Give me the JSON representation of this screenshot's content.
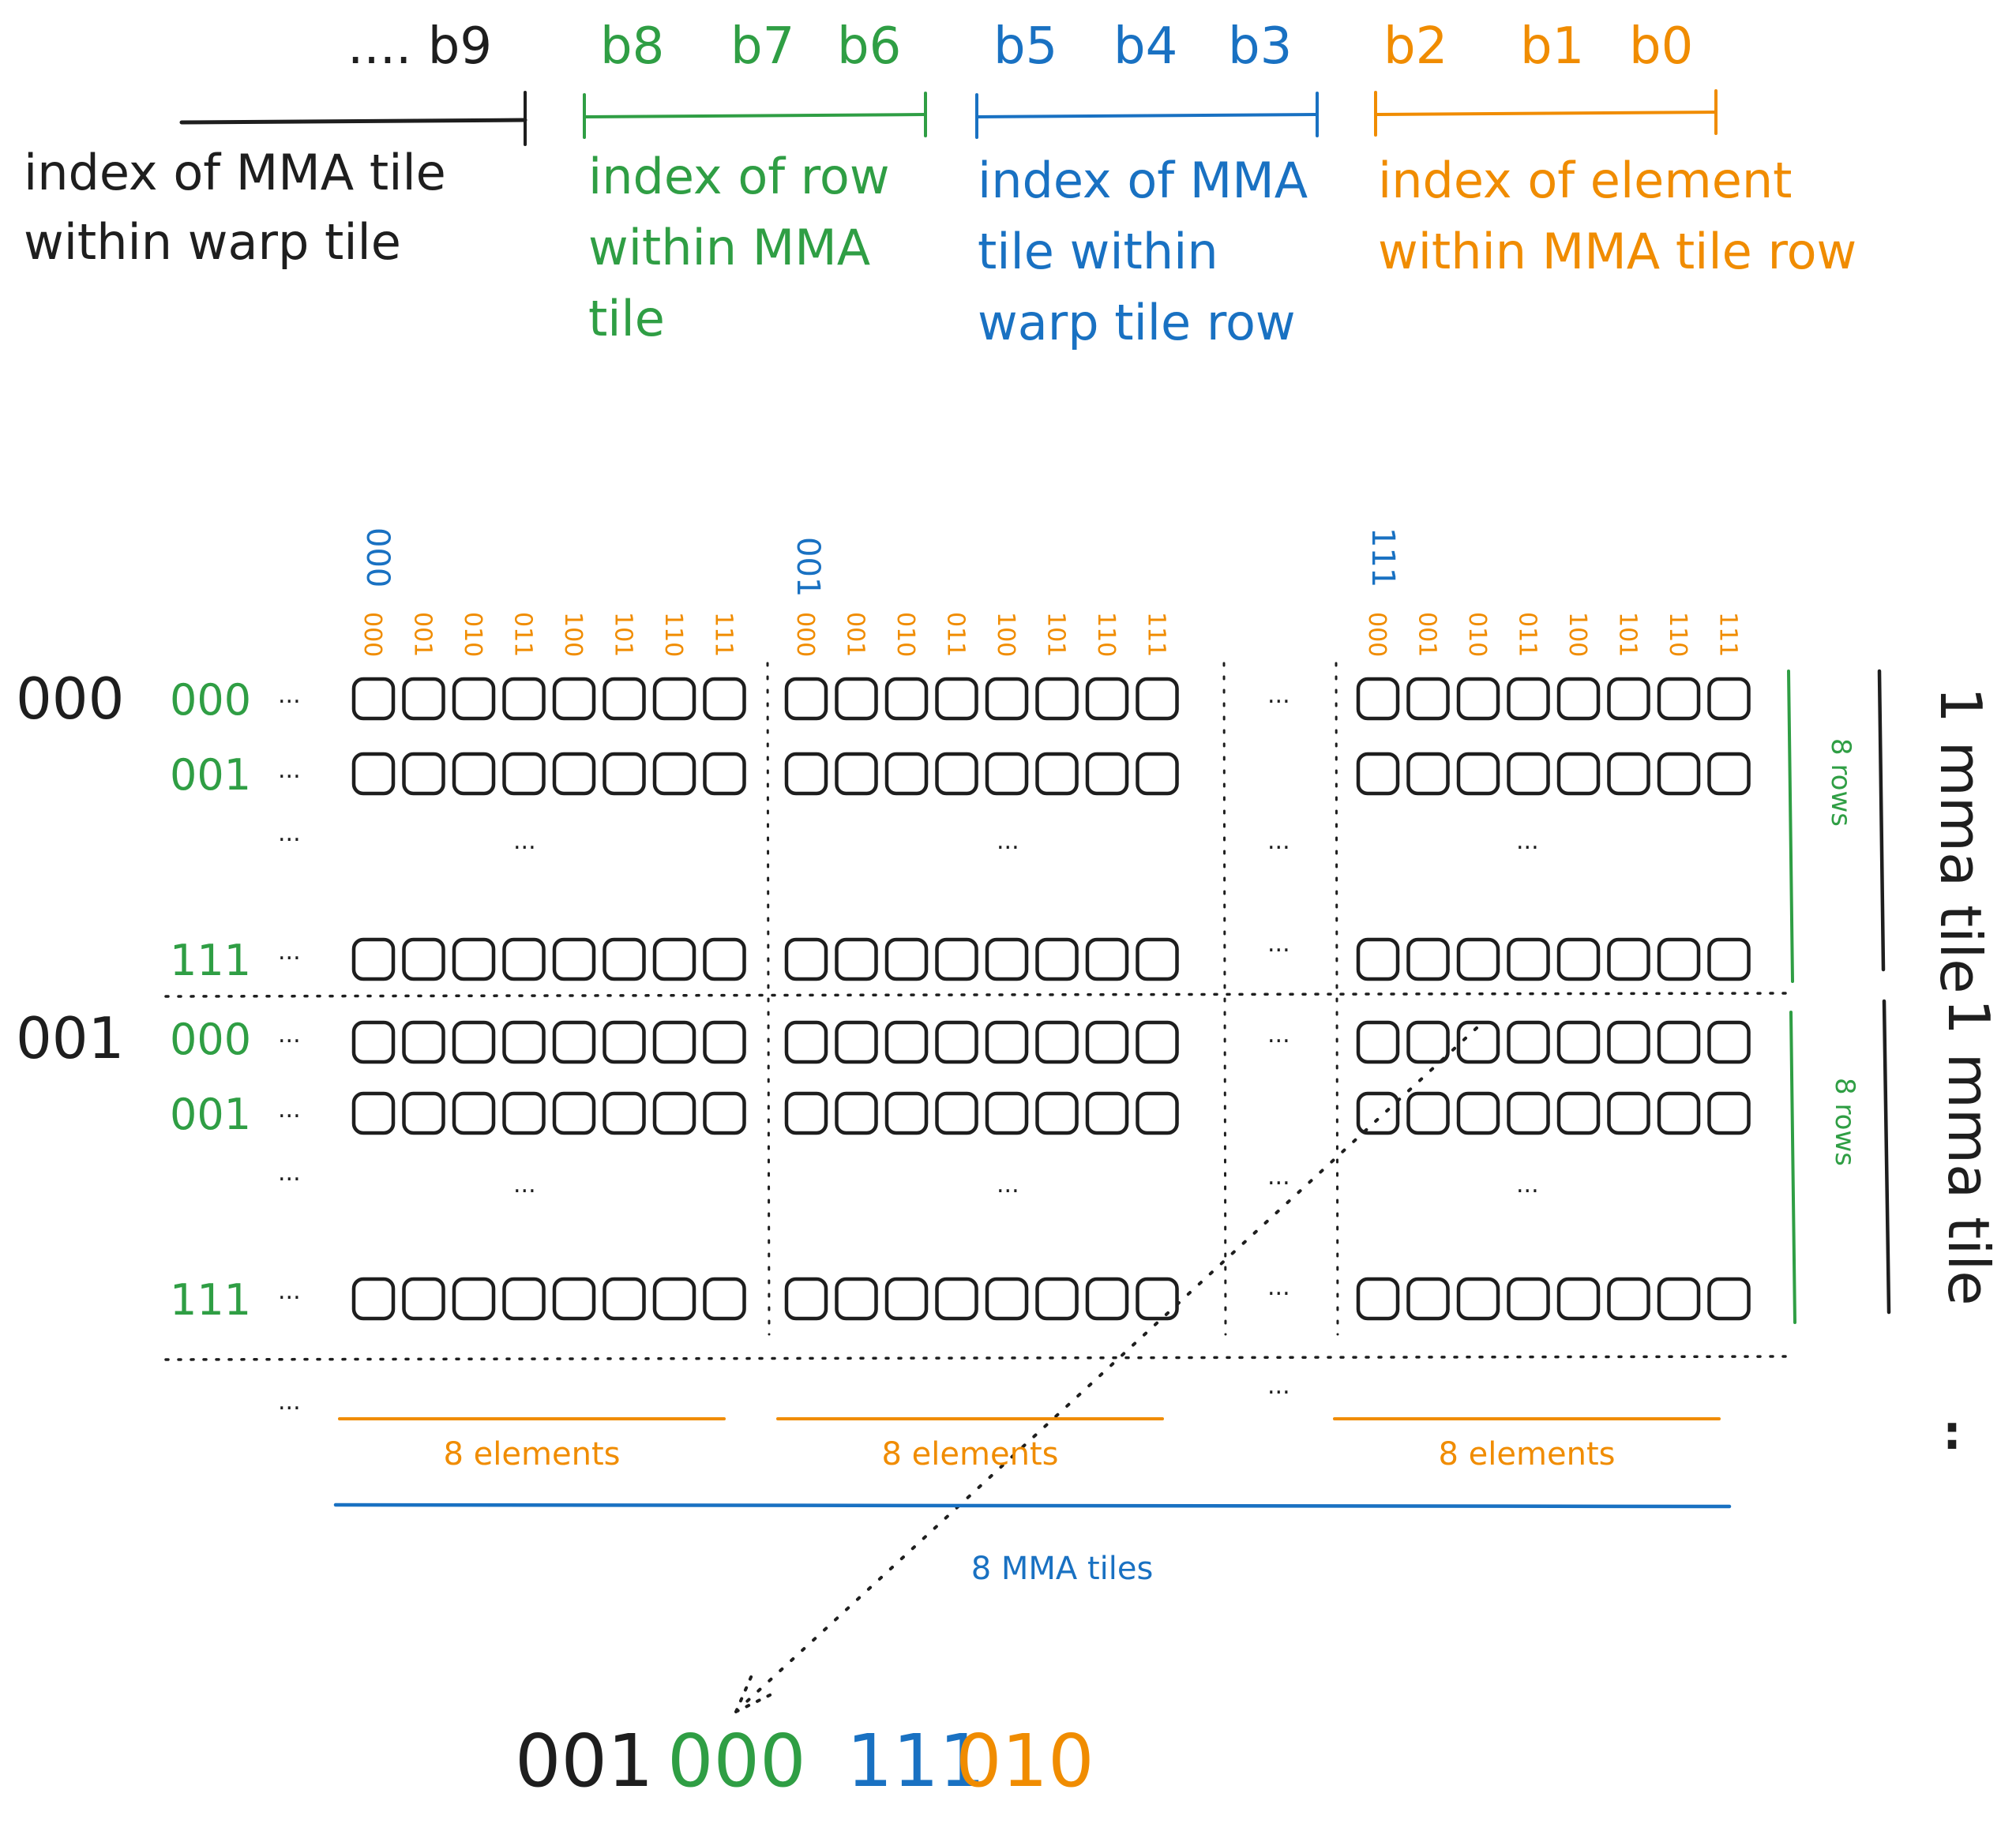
{
  "colors": {
    "black": "#1e1e1e",
    "green": "#2f9e44",
    "blue": "#1971c2",
    "orange": "#f08c00"
  },
  "bit_header": {
    "groups": [
      {
        "id": "warp",
        "color": "black",
        "bits_label": ".... b9",
        "description": [
          "index of MMA tile",
          "within warp tile"
        ]
      },
      {
        "id": "row",
        "color": "green",
        "bits": [
          "b8",
          "b7",
          "b6"
        ],
        "description": [
          "index of row",
          "within MMA",
          "tile"
        ]
      },
      {
        "id": "mma-col",
        "color": "blue",
        "bits": [
          "b5",
          "b4",
          "b3"
        ],
        "description": [
          "index of MMA",
          "tile within",
          "warp tile row"
        ]
      },
      {
        "id": "element",
        "color": "orange",
        "bits": [
          "b2",
          "b1",
          "b0"
        ],
        "description": [
          "index of element",
          "within MMA tile row"
        ]
      }
    ]
  },
  "grid": {
    "mma_col_labels": [
      "000",
      "001",
      "111"
    ],
    "element_labels": [
      "000",
      "001",
      "010",
      "011",
      "100",
      "101",
      "110",
      "111"
    ],
    "tile_row_labels": [
      "000",
      "001"
    ],
    "row_labels": [
      "000",
      "001",
      "111"
    ],
    "ellipsis": "...",
    "cells_per_row": 8
  },
  "annotations": {
    "rows_label": "8 rows",
    "mma_tile_label": "1 mma tile",
    "elements_label": "8 elements",
    "mma_tiles_label": "8 MMA tiles",
    "right_ellipsis": ":"
  },
  "result": {
    "parts": [
      {
        "text": "001",
        "color": "black"
      },
      {
        "text": "000",
        "color": "green"
      },
      {
        "text": "111",
        "color": "blue"
      },
      {
        "text": "010",
        "color": "orange"
      }
    ]
  }
}
